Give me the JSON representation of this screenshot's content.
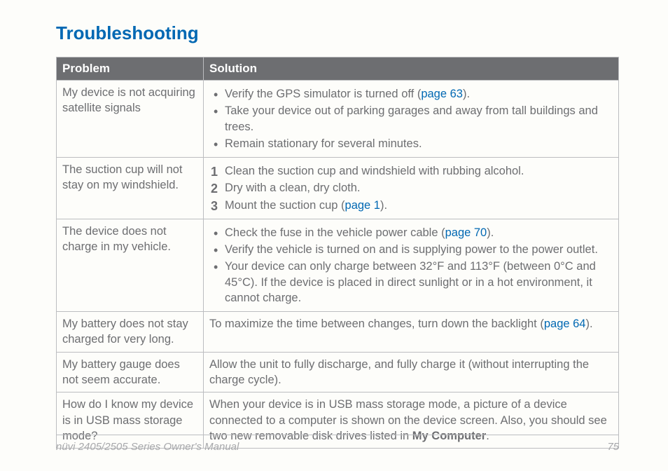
{
  "title": "Troubleshooting",
  "headers": {
    "problem": "Problem",
    "solution": "Solution"
  },
  "rows": {
    "r1": {
      "problem": "My device is not acquiring satellite signals",
      "b1_pre": "Verify the GPS simulator is turned off (",
      "b1_link": "page 63",
      "b1_post": ").",
      "b2": "Take your device out of parking garages and away from tall buildings and trees.",
      "b3": "Remain stationary for several minutes."
    },
    "r2": {
      "problem": "The suction cup will not stay on my windshield.",
      "s1": "Clean the suction cup and windshield with rubbing alcohol.",
      "s2": "Dry with a clean, dry cloth.",
      "s3_pre": "Mount the suction cup (",
      "s3_link": "page 1",
      "s3_post": ")."
    },
    "r3": {
      "problem": "The device does not charge in my vehicle.",
      "b1_pre": "Check the fuse in the vehicle power cable (",
      "b1_link": "page 70",
      "b1_post": ").",
      "b2": "Verify the vehicle is turned on and is supplying power to the power outlet.",
      "b3": "Your device can only charge between 32°F and 113°F (between 0°C and 45°C). If the device is placed in direct sunlight or in a hot environment, it cannot charge."
    },
    "r4": {
      "problem": "My battery does not stay charged for very long.",
      "sol_pre": "To maximize the time between changes, turn down the backlight (",
      "sol_link": "page 64",
      "sol_post": ")."
    },
    "r5": {
      "problem": "My battery gauge does not seem accurate.",
      "sol": "Allow the unit to fully discharge, and fully charge it (without interrupting the charge cycle)."
    },
    "r6": {
      "problem": "How do I know my device is in USB mass storage mode?",
      "sol_pre": "When your device is in USB mass storage mode, a picture of a device connected to a computer is shown on the device screen. Also, you should see two new removable disk drives listed in ",
      "sol_bold": "My Computer",
      "sol_post": "."
    }
  },
  "footer": {
    "left": "nüvi 2405/2505 Series Owner's Manual",
    "right": "75"
  }
}
